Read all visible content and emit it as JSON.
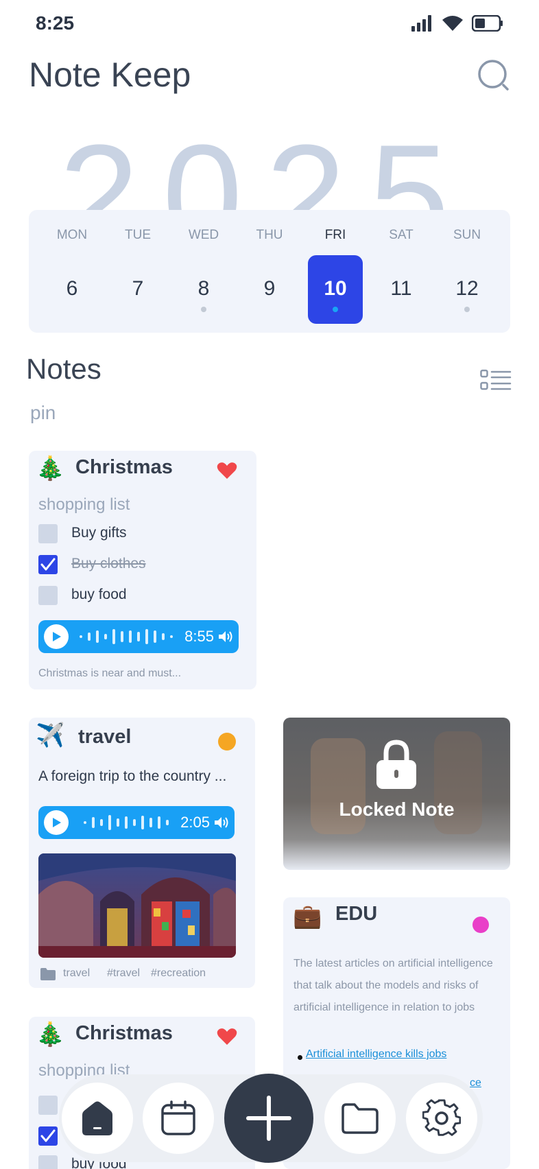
{
  "status": {
    "time": "8:25"
  },
  "app": {
    "title": "Note Keep",
    "year": "2025"
  },
  "calendar": {
    "days": [
      {
        "name": "MON",
        "num": "6"
      },
      {
        "name": "TUE",
        "num": "7"
      },
      {
        "name": "WED",
        "num": "8"
      },
      {
        "name": "THU",
        "num": "9"
      },
      {
        "name": "FRI",
        "num": "10"
      },
      {
        "name": "SAT",
        "num": "11"
      },
      {
        "name": "SUN",
        "num": "12"
      }
    ],
    "selected": "10"
  },
  "notes": {
    "title": "Notes",
    "pin_label": "pin"
  },
  "cards": {
    "christmas": {
      "emoji": "🎄",
      "title": "Christmas",
      "subtitle": "shopping list",
      "items": [
        {
          "label": "Buy gifts",
          "checked": false
        },
        {
          "label": "Buy clothes",
          "checked": true
        },
        {
          "label": "buy food",
          "checked": false
        }
      ],
      "audio_duration": "8:55",
      "footer": "Christmas is near and must..."
    },
    "travel": {
      "emoji": "✈️",
      "title": "travel",
      "text": "A foreign trip to the country ...",
      "audio_duration": "2:05",
      "folder": "travel",
      "tags": [
        "#travel",
        "#recreation"
      ],
      "dot_color": "#f5a623"
    },
    "locked": {
      "label": "Locked Note"
    },
    "edu": {
      "emoji": "💼",
      "title": "EDU",
      "text_lines": [
        "The latest articles on artificial intelligence",
        "that talk about the models and risks of",
        "artificial intelligence in relation to jobs"
      ],
      "link1": "Artificial intelligence kills jobs",
      "link2_partial": "ce",
      "dot_color": "#e93fc8"
    },
    "christmas2": {
      "emoji": "🎄",
      "title": "Christmas",
      "subtitle": "shopping list",
      "item3": "buy food"
    }
  },
  "colors": {
    "accent": "#2d45e6",
    "audio": "#19a0f5",
    "heart": "#f0474a"
  }
}
